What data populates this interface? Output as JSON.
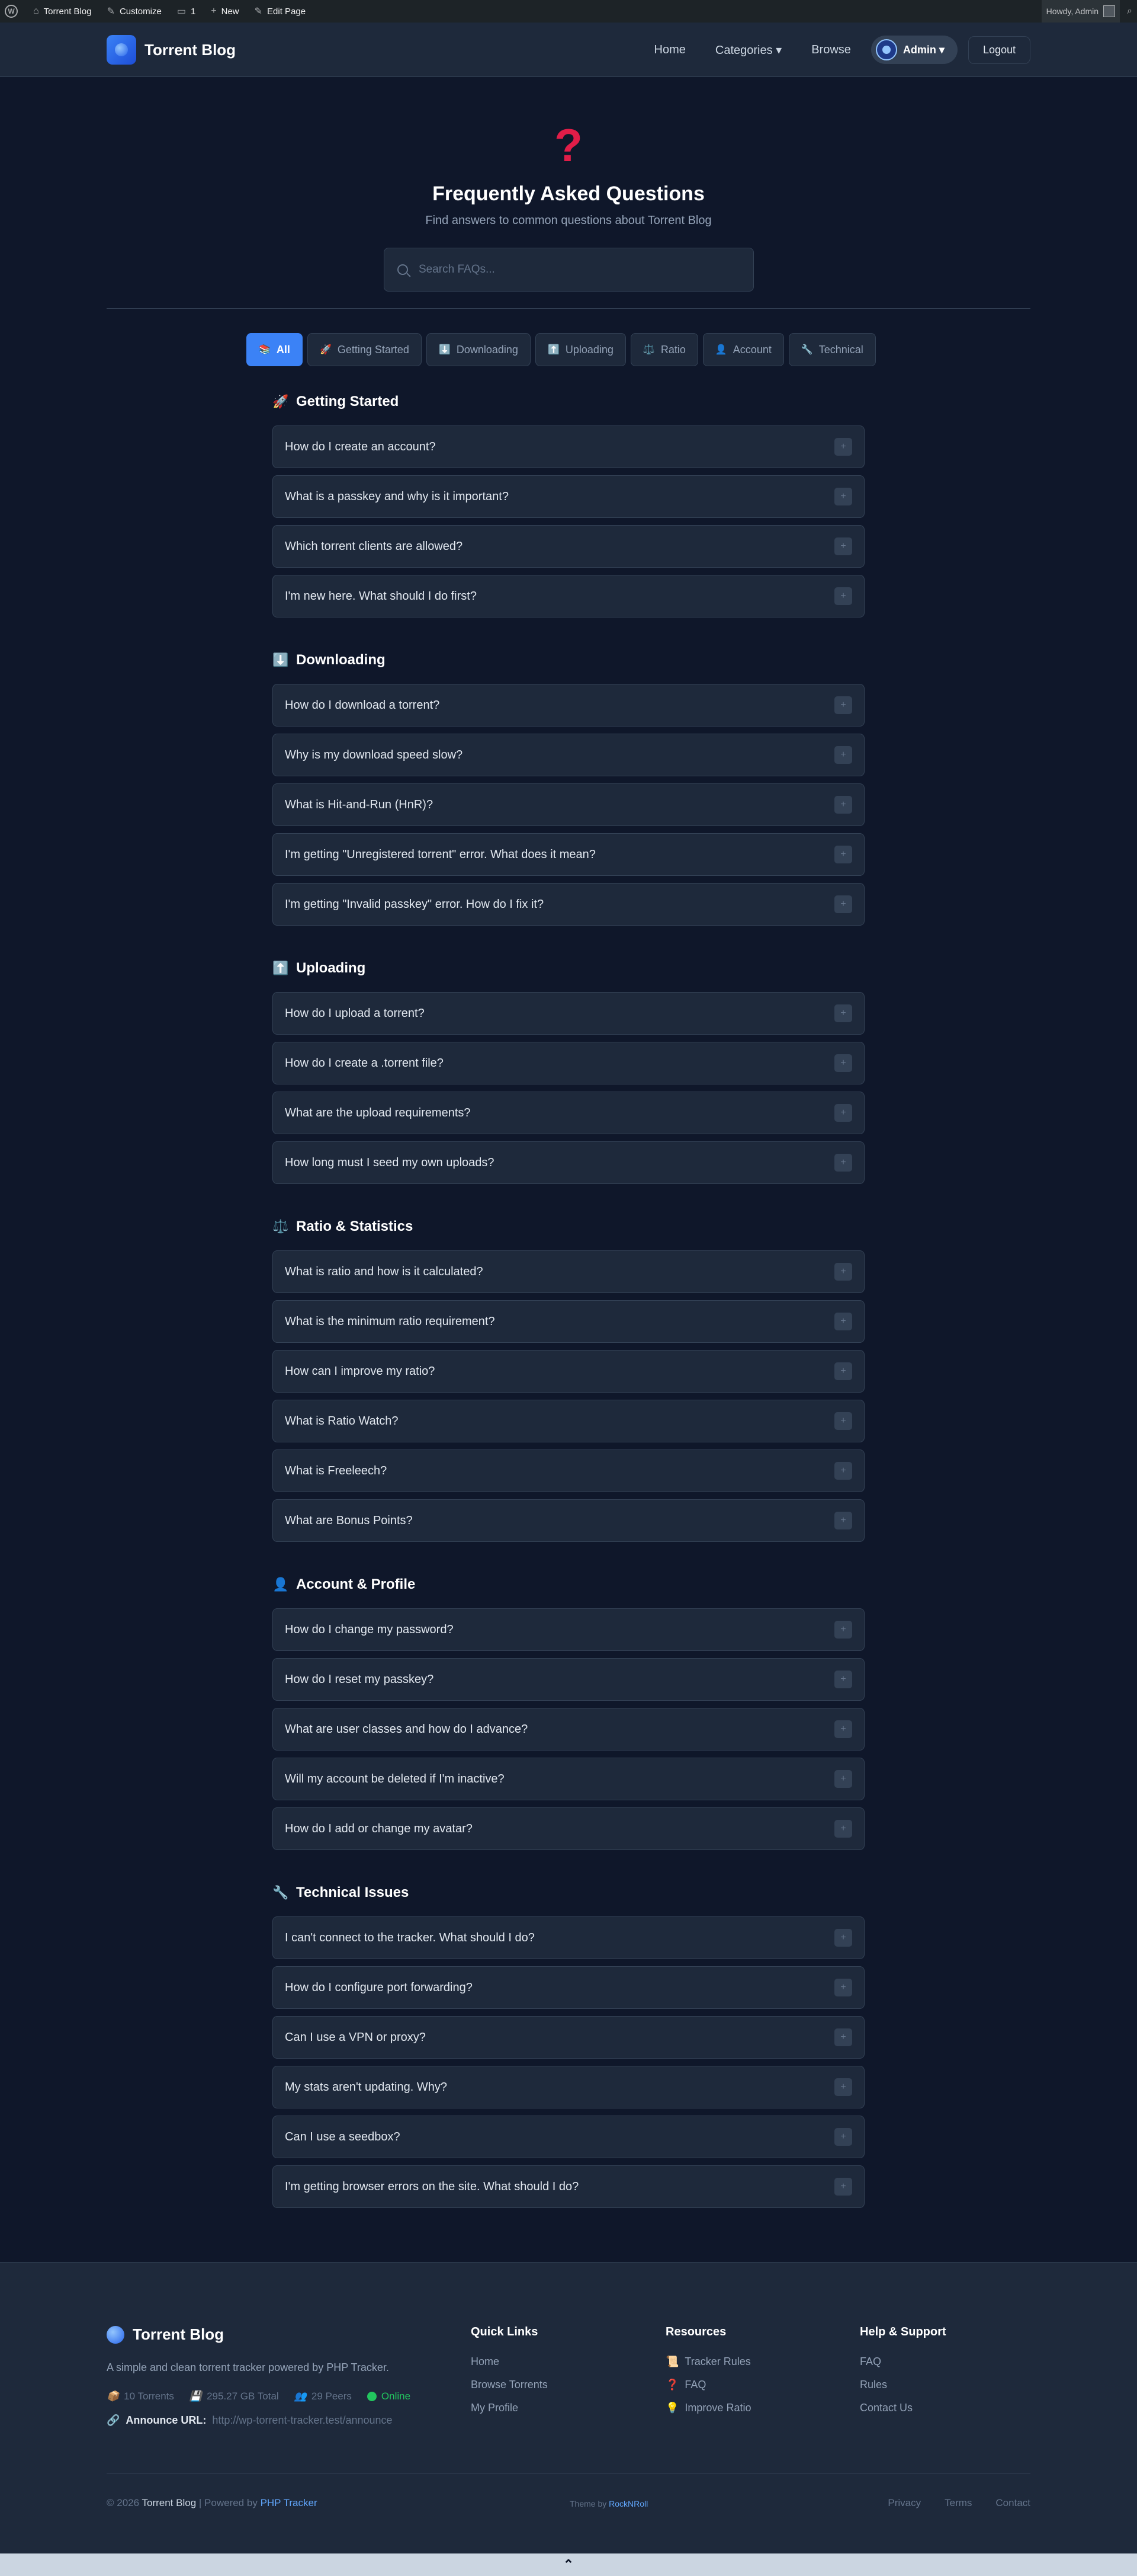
{
  "adminbar": {
    "site": "Torrent Blog",
    "customize": "Customize",
    "comments": "1",
    "new": "New",
    "edit": "Edit Page",
    "howdy": "Howdy, Admin"
  },
  "header": {
    "brand": "Torrent Blog",
    "nav": {
      "home": "Home",
      "categories": "Categories ▾",
      "browse": "Browse",
      "admin": "Admin ▾",
      "logout": "Logout"
    }
  },
  "hero": {
    "icon": "?",
    "title": "Frequently Asked Questions",
    "subtitle": "Find answers to common questions about Torrent Blog",
    "search_placeholder": "Search FAQs..."
  },
  "tabs": [
    {
      "icon": "📚",
      "label": "All",
      "active": true
    },
    {
      "icon": "🚀",
      "label": "Getting Started"
    },
    {
      "icon": "⬇️",
      "label": "Downloading"
    },
    {
      "icon": "⬆️",
      "label": "Uploading"
    },
    {
      "icon": "⚖️",
      "label": "Ratio"
    },
    {
      "icon": "👤",
      "label": "Account"
    },
    {
      "icon": "🔧",
      "label": "Technical"
    }
  ],
  "sections": [
    {
      "icon": "🚀",
      "title": "Getting Started",
      "questions": [
        "How do I create an account?",
        "What is a passkey and why is it important?",
        "Which torrent clients are allowed?",
        "I'm new here. What should I do first?"
      ]
    },
    {
      "icon": "⬇️",
      "title": "Downloading",
      "questions": [
        "How do I download a torrent?",
        "Why is my download speed slow?",
        "What is Hit-and-Run (HnR)?",
        "I'm getting \"Unregistered torrent\" error. What does it mean?",
        "I'm getting \"Invalid passkey\" error. How do I fix it?"
      ]
    },
    {
      "icon": "⬆️",
      "title": "Uploading",
      "questions": [
        "How do I upload a torrent?",
        "How do I create a .torrent file?",
        "What are the upload requirements?",
        "How long must I seed my own uploads?"
      ]
    },
    {
      "icon": "⚖️",
      "title": "Ratio & Statistics",
      "questions": [
        "What is ratio and how is it calculated?",
        "What is the minimum ratio requirement?",
        "How can I improve my ratio?",
        "What is Ratio Watch?",
        "What is Freeleech?",
        "What are Bonus Points?"
      ]
    },
    {
      "icon": "👤",
      "title": "Account & Profile",
      "questions": [
        "How do I change my password?",
        "How do I reset my passkey?",
        "What are user classes and how do I advance?",
        "Will my account be deleted if I'm inactive?",
        "How do I add or change my avatar?"
      ]
    },
    {
      "icon": "🔧",
      "title": "Technical Issues",
      "questions": [
        "I can't connect to the tracker. What should I do?",
        "How do I configure port forwarding?",
        "Can I use a VPN or proxy?",
        "My stats aren't updating. Why?",
        "Can I use a seedbox?",
        "I'm getting browser errors on the site. What should I do?"
      ]
    }
  ],
  "footer": {
    "brand": "Torrent Blog",
    "description": "A simple and clean torrent tracker powered by PHP Tracker.",
    "stats": {
      "torrents": "10 Torrents",
      "size": "295.27 GB Total",
      "peers": "29 Peers",
      "online": "Online"
    },
    "announce_label": "Announce URL:",
    "announce_url": "http://wp-torrent-tracker.test/announce",
    "quick_links": {
      "title": "Quick Links",
      "items": [
        "Home",
        "Browse Torrents",
        "My Profile"
      ]
    },
    "resources": {
      "title": "Resources",
      "items": [
        {
          "icon": "📜",
          "label": "Tracker Rules"
        },
        {
          "icon": "❓",
          "label": "FAQ"
        },
        {
          "icon": "💡",
          "label": "Improve Ratio"
        }
      ]
    },
    "help": {
      "title": "Help & Support",
      "items": [
        "FAQ",
        "Rules",
        "Contact Us"
      ]
    },
    "copyright_prefix": "© 2026",
    "copyright_brand": "Torrent Blog",
    "powered_prefix": "| Powered by",
    "powered_link": "PHP Tracker",
    "theme_prefix": "Theme by",
    "theme_link": "RockNRoll",
    "legal": [
      "Privacy",
      "Terms",
      "Contact"
    ]
  }
}
